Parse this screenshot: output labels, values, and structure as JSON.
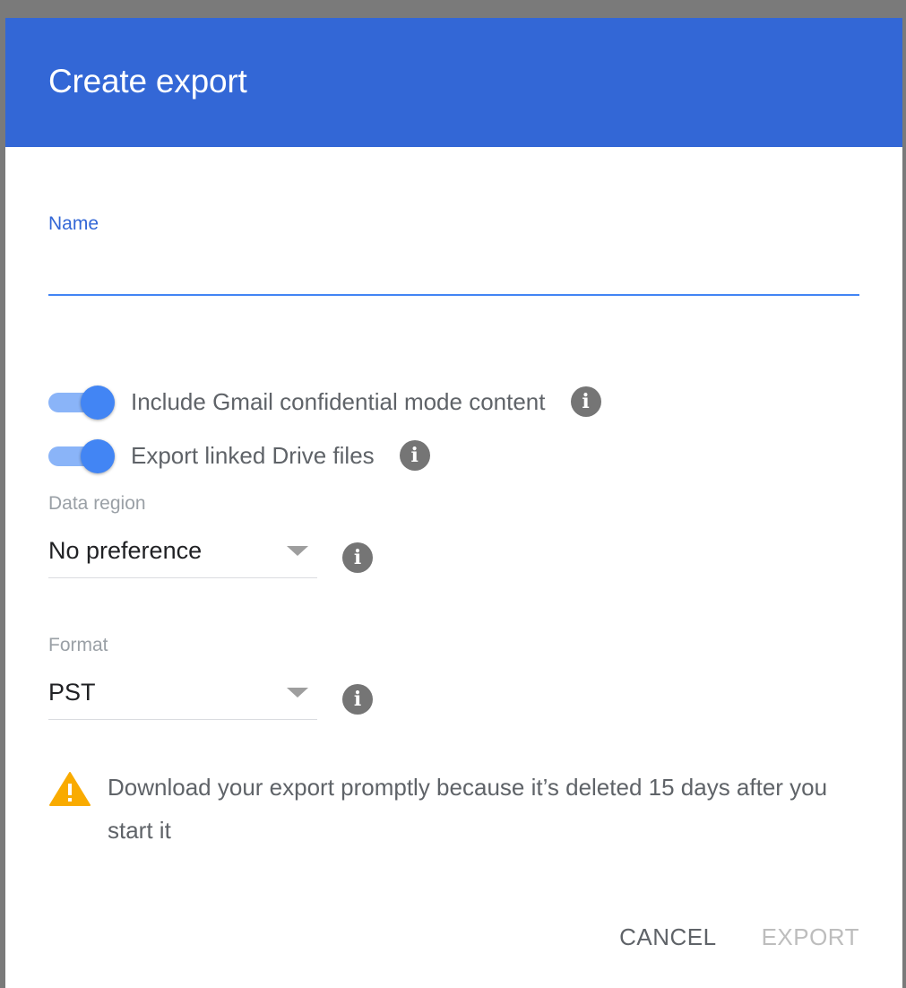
{
  "dialog": {
    "title": "Create export"
  },
  "name_field": {
    "label": "Name",
    "value": ""
  },
  "toggles": [
    {
      "label": "Include Gmail confidential mode content",
      "on": true
    },
    {
      "label": "Export linked Drive files",
      "on": true
    }
  ],
  "data_region": {
    "label": "Data region",
    "selected": "No preference"
  },
  "format": {
    "label": "Format",
    "selected": "PST"
  },
  "warning": {
    "text": "Download your export promptly because it’s deleted 15 days after you start it"
  },
  "actions": {
    "cancel_label": "CANCEL",
    "export_label": "EXPORT"
  },
  "colors": {
    "header": "#3367d6",
    "accent": "#4285f4",
    "warning": "#f9ab00"
  },
  "icons": {
    "info": "i"
  }
}
